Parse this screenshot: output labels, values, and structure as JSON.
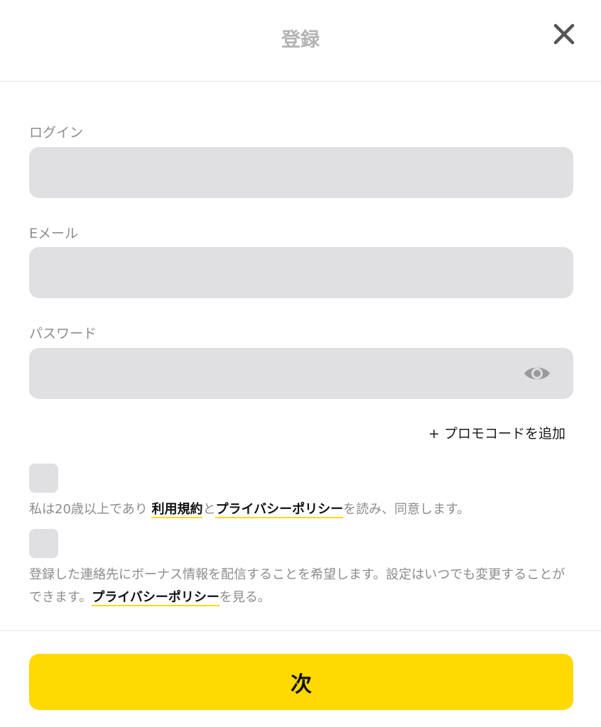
{
  "header": {
    "title": "登録",
    "close_icon": "close-icon"
  },
  "form": {
    "login": {
      "label": "ログイン",
      "value": "",
      "placeholder": ""
    },
    "email": {
      "label": "Eメール",
      "value": "",
      "placeholder": ""
    },
    "password": {
      "label": "パスワード",
      "value": "",
      "placeholder": "",
      "toggle_icon": "eye-icon"
    }
  },
  "promo": {
    "label": "+ プロモコードを追加"
  },
  "consent_age": {
    "checked": false,
    "text_before": "私は20歳以上であり ",
    "terms_link": "利用規約",
    "text_and": "と",
    "privacy_link": "プライバシーポリシー",
    "text_after": "を読み、同意します。"
  },
  "consent_marketing": {
    "checked": false,
    "text_before": "登録した連絡先にボーナス情報を配信することを希望します。設定はいつでも変更することができます。",
    "privacy_link": "プライバシーポリシー",
    "text_after": "を見る。"
  },
  "footer": {
    "next_label": "次"
  },
  "colors": {
    "accent": "#ffd900",
    "field_bg": "#e0e0e2",
    "muted_text": "#8c8c8c"
  }
}
